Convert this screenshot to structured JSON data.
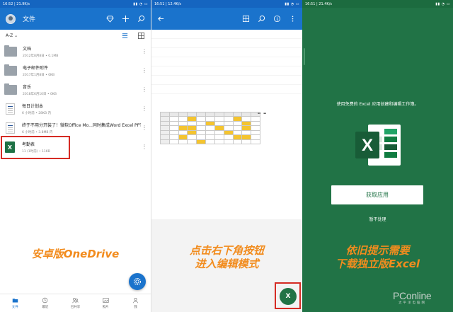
{
  "panel1": {
    "status": {
      "time": "16:52",
      "speed": "21.9K/s",
      "battery": ""
    },
    "header": {
      "title": "文件"
    },
    "sort": {
      "label": "A-Z"
    },
    "files": [
      {
        "name": "文档",
        "meta": "2012年8月8日 • 0.1MB",
        "type": "folder"
      },
      {
        "name": "电子邮件附件",
        "meta": "2017年1月8日 • 0KB",
        "type": "folder"
      },
      {
        "name": "音乐",
        "meta": "2018年6月10日 • 0KB",
        "type": "folder"
      },
      {
        "name": "每日计划本",
        "meta": "6 小时前 • 28KB 内",
        "type": "doc"
      },
      {
        "name": "终于不用分开装了！微软Office Mo...同时集成Word Excel PPT PDF",
        "meta": "6 小时前 • 3.8MB 内",
        "type": "doc"
      },
      {
        "name": "考勤表",
        "meta": "11 (1时前) • 11KB",
        "type": "xls"
      }
    ],
    "caption": "安卓版OneDrive",
    "bottom_nav": [
      {
        "label": "文件",
        "icon": "folder-icon",
        "active": true
      },
      {
        "label": "最近",
        "icon": "clock-icon",
        "active": false
      },
      {
        "label": "已共享",
        "icon": "people-icon",
        "active": false
      },
      {
        "label": "照片",
        "icon": "photo-icon",
        "active": false
      },
      {
        "label": "我",
        "icon": "person-icon",
        "active": false
      }
    ]
  },
  "panel2": {
    "status": {
      "time": "16:51",
      "speed": "12.4K/s"
    },
    "caption_line1": "点击右下角按钮",
    "caption_line2": "进入编辑模式",
    "edit_button_label": "X"
  },
  "panel3": {
    "status": {
      "time": "16:51",
      "speed": "21.4K/s"
    },
    "prompt": "使用免费的 Excel 应用创建和编辑工作簿。",
    "logo_letter": "X",
    "get_app_label": "获取应用",
    "not_now_label": "暂不处理",
    "caption_line1": "依旧提示需要",
    "caption_line2": "下载独立版Excel",
    "watermark": "PConline",
    "watermark_sub": "太平洋电脑网"
  },
  "colors": {
    "onedrive_blue": "#1a73cc",
    "excel_green": "#217346",
    "caption_orange": "#f28c1e",
    "highlight_red": "#d52b24"
  }
}
